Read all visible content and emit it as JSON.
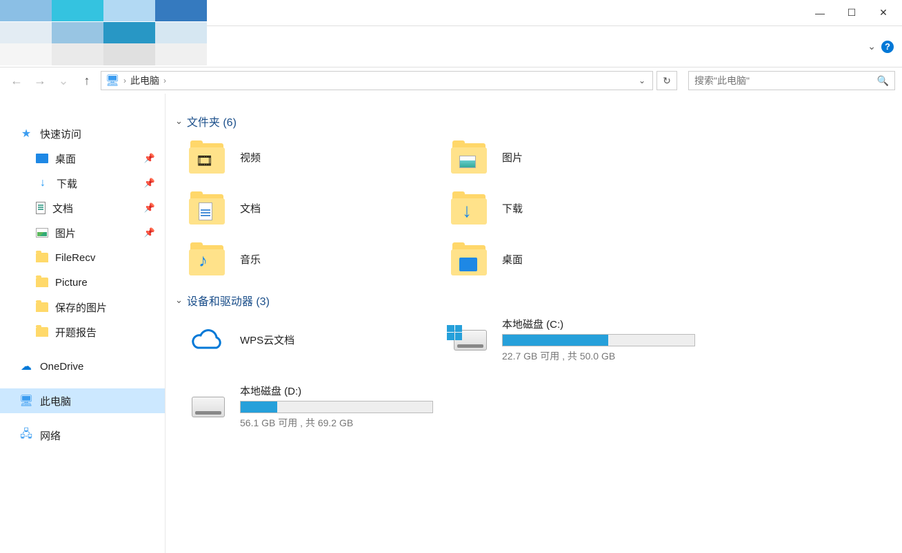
{
  "window": {
    "minimize": "—",
    "maximize": "☐",
    "close": "✕"
  },
  "address": {
    "location": "此电脑",
    "separator": "›"
  },
  "search": {
    "placeholder": "搜索\"此电脑\""
  },
  "nav": {
    "quick_access": "快速访问",
    "desktop": "桌面",
    "downloads": "下载",
    "documents": "文档",
    "pictures": "图片",
    "filerecv": "FileRecv",
    "picture_en": "Picture",
    "saved_pics": "保存的图片",
    "report": "开题报告",
    "onedrive": "OneDrive",
    "this_pc": "此电脑",
    "network": "网络"
  },
  "groups": {
    "folders_header": "文件夹 (6)",
    "devices_header": "设备和驱动器 (3)"
  },
  "folders": {
    "videos": "视频",
    "pictures": "图片",
    "documents": "文档",
    "downloads": "下载",
    "music": "音乐",
    "desktop": "桌面"
  },
  "drives": {
    "wps": "WPS云文档",
    "c": {
      "name": "本地磁盘 (C:)",
      "text": "22.7 GB 可用 , 共 50.0 GB",
      "fill_pct": 55
    },
    "d": {
      "name": "本地磁盘 (D:)",
      "text": "56.1 GB 可用 , 共 69.2 GB",
      "fill_pct": 19
    }
  }
}
